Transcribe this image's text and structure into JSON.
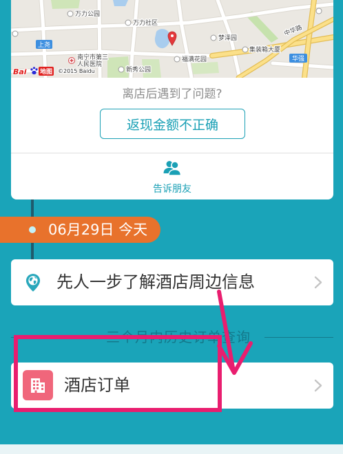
{
  "colors": {
    "page_background": "#1aa4b9",
    "accent": "#1aa0b5",
    "timeline_line": "#1f5b6c",
    "date_badge": "#e8722c",
    "hotel_icon_bg": "#f0667b",
    "annotation": "#e91e6f",
    "section_text": "#14798b"
  },
  "map": {
    "labels": {
      "wanli_park": "万力公园",
      "wanli_community": "万力社区",
      "shangyao": "上尧",
      "hospital_line1": "南宁市第三",
      "hospital_line2": "人民医院",
      "mengze_garden": "梦泽园",
      "container_tower": "集装箱大厦",
      "huaqiang": "华强",
      "zhonghua_road": "中华路",
      "fuman_garden": "福满花园",
      "xinxiu_park": "新秀公园"
    },
    "logo": {
      "bai": "Bai",
      "ditu": "地图"
    },
    "copyright": "©2015 Baidu"
  },
  "problem_card": {
    "prompt": "离店后遇到了问题?",
    "cashback_button": "返现金额不正确",
    "share_label": "告诉朋友"
  },
  "timeline": {
    "date_label": "06月29日 今天"
  },
  "nearby_info": {
    "label": "先人一步了解酒店周边信息"
  },
  "history": {
    "section_title": "三个月内历史订单查询",
    "hotel_orders_label": "酒店订单"
  },
  "icons": {
    "map_marker": "map-pin-icon",
    "share": "people-icon",
    "nearby": "location-globe-icon",
    "hotel": "building-icon",
    "chevron": "chevron-right-icon"
  }
}
